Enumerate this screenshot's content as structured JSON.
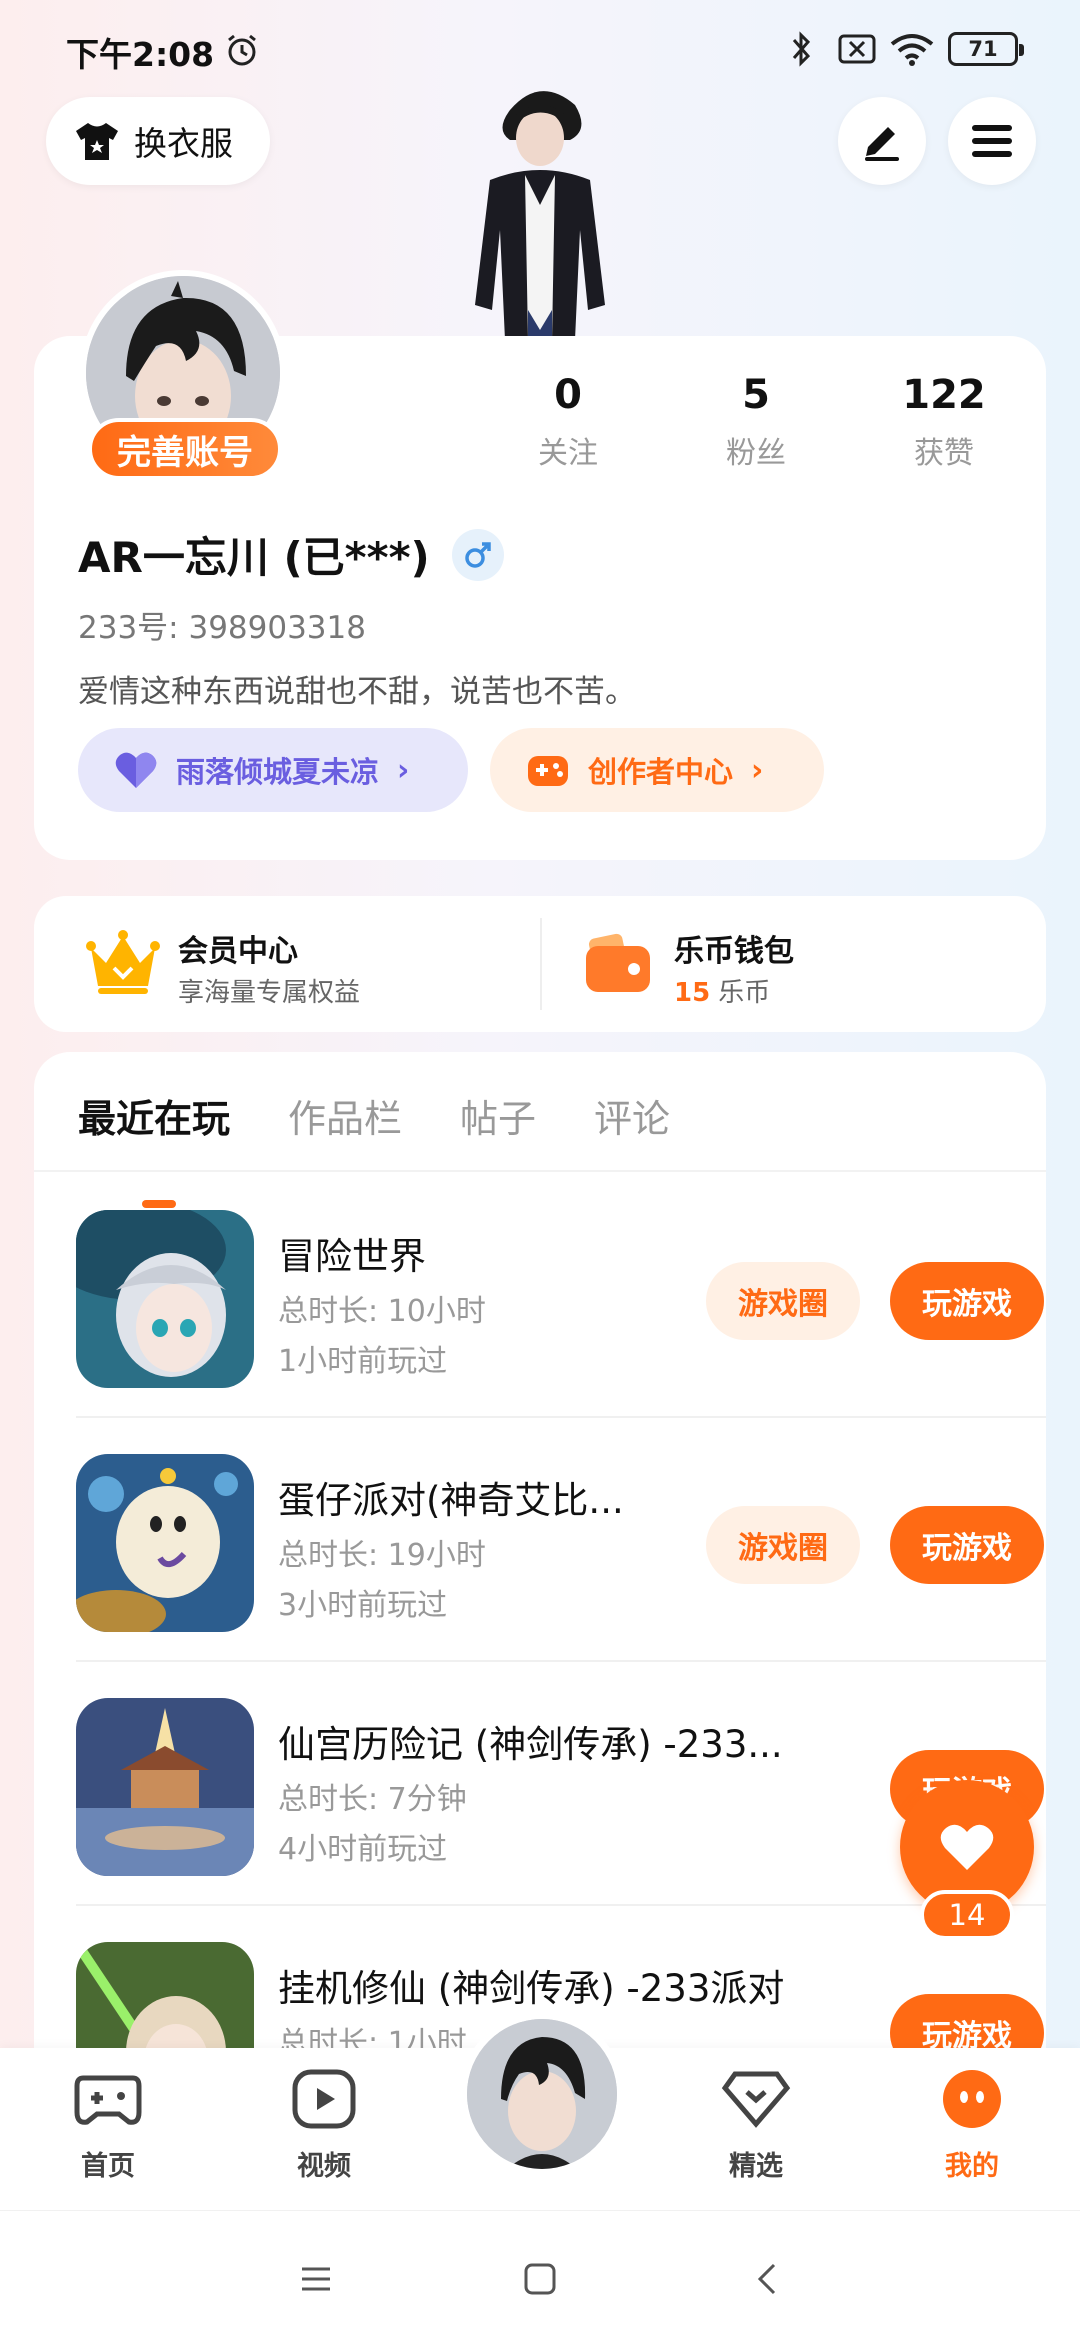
{
  "status_bar": {
    "time": "下午2:08",
    "battery": "71"
  },
  "top": {
    "wardrobe_label": "换衣服"
  },
  "profile": {
    "badge": "完善账号",
    "stats": [
      {
        "value": "0",
        "label": "关注"
      },
      {
        "value": "5",
        "label": "粉丝"
      },
      {
        "value": "122",
        "label": "获赞"
      }
    ],
    "username": "AR一忘川 (已***)",
    "uid": "233号: 398903318",
    "bio": "爱情这种东西说甜也不甜，说苦也不苦。",
    "group_pill": "雨落倾城夏未凉",
    "creator_pill": "创作者中心"
  },
  "wallet": {
    "member_title": "会员中心",
    "member_sub": "享海量专属权益",
    "wallet_title": "乐币钱包",
    "wallet_amount": "15",
    "wallet_unit": "乐币"
  },
  "tabs": [
    "最近在玩",
    "作品栏",
    "帖子",
    "评论"
  ],
  "games": [
    {
      "name": "冒险世界",
      "duration": "总时长: 10小时",
      "last": "1小时前玩过",
      "circle_btn": "游戏圈",
      "play_btn": "玩游戏"
    },
    {
      "name": "蛋仔派对(神奇艾比...",
      "duration": "总时长: 19小时",
      "last": "3小时前玩过",
      "circle_btn": "游戏圈",
      "play_btn": "玩游戏"
    },
    {
      "name": "仙宫历险记 (神剑传承) -233...",
      "duration": "总时长: 7分钟",
      "last": "4小时前玩过",
      "circle_btn": "",
      "play_btn": "玩游戏"
    },
    {
      "name": "挂机修仙 (神剑传承) -233派对",
      "duration": "总时长: 1小时",
      "last": "",
      "circle_btn": "",
      "play_btn": "玩游戏"
    }
  ],
  "like_count": "14",
  "nav": [
    "首页",
    "视频",
    "精选",
    "我的"
  ],
  "colors": {
    "accent": "#ff6a14",
    "group": "#6a5ee0"
  }
}
